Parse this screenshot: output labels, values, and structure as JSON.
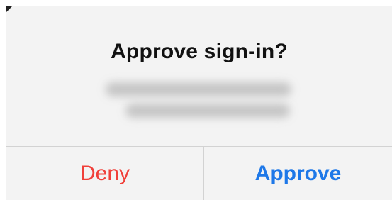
{
  "dialog": {
    "title": "Approve sign-in?",
    "deny_label": "Deny",
    "approve_label": "Approve"
  },
  "colors": {
    "deny": "#f0403a",
    "approve": "#1e78e8",
    "background": "#f3f3f3",
    "divider": "#d2d2d2"
  }
}
